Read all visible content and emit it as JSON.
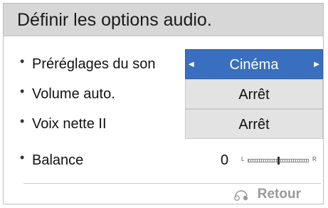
{
  "dialog": {
    "title": "Définir les options audio."
  },
  "options": [
    {
      "label": "Préréglages du son",
      "value": "Cinéma",
      "selected": true
    },
    {
      "label": "Volume auto.",
      "value": "Arrêt",
      "selected": false
    },
    {
      "label": "Voix nette II",
      "value": "Arrêt",
      "selected": false
    }
  ],
  "balance": {
    "label": "Balance",
    "value": "0",
    "left_label": "L",
    "right_label": "R",
    "level_fraction": 0.5
  },
  "footer": {
    "back_label": "Retour",
    "back_icon": "return-icon"
  },
  "colors": {
    "selected_bg": "#3a6fbf",
    "title_bg": "#d7d7d7"
  }
}
